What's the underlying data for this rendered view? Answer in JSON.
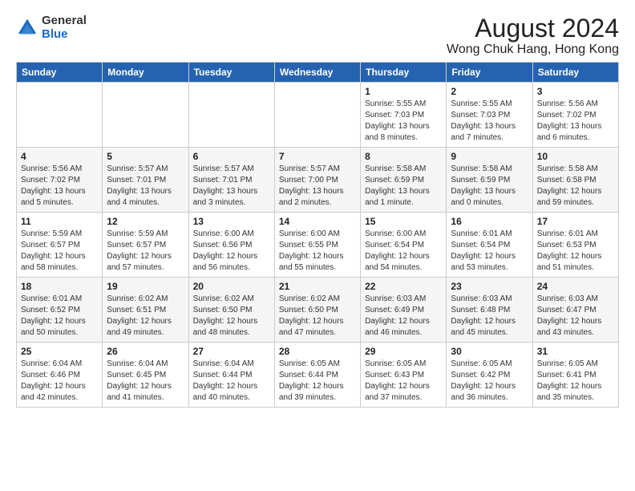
{
  "logo": {
    "general": "General",
    "blue": "Blue"
  },
  "header": {
    "title": "August 2024",
    "subtitle": "Wong Chuk Hang, Hong Kong"
  },
  "weekdays": [
    "Sunday",
    "Monday",
    "Tuesday",
    "Wednesday",
    "Thursday",
    "Friday",
    "Saturday"
  ],
  "weeks": [
    [
      {
        "day": "",
        "details": ""
      },
      {
        "day": "",
        "details": ""
      },
      {
        "day": "",
        "details": ""
      },
      {
        "day": "",
        "details": ""
      },
      {
        "day": "1",
        "details": "Sunrise: 5:55 AM\nSunset: 7:03 PM\nDaylight: 13 hours\nand 8 minutes."
      },
      {
        "day": "2",
        "details": "Sunrise: 5:55 AM\nSunset: 7:03 PM\nDaylight: 13 hours\nand 7 minutes."
      },
      {
        "day": "3",
        "details": "Sunrise: 5:56 AM\nSunset: 7:02 PM\nDaylight: 13 hours\nand 6 minutes."
      }
    ],
    [
      {
        "day": "4",
        "details": "Sunrise: 5:56 AM\nSunset: 7:02 PM\nDaylight: 13 hours\nand 5 minutes."
      },
      {
        "day": "5",
        "details": "Sunrise: 5:57 AM\nSunset: 7:01 PM\nDaylight: 13 hours\nand 4 minutes."
      },
      {
        "day": "6",
        "details": "Sunrise: 5:57 AM\nSunset: 7:01 PM\nDaylight: 13 hours\nand 3 minutes."
      },
      {
        "day": "7",
        "details": "Sunrise: 5:57 AM\nSunset: 7:00 PM\nDaylight: 13 hours\nand 2 minutes."
      },
      {
        "day": "8",
        "details": "Sunrise: 5:58 AM\nSunset: 6:59 PM\nDaylight: 13 hours\nand 1 minute."
      },
      {
        "day": "9",
        "details": "Sunrise: 5:58 AM\nSunset: 6:59 PM\nDaylight: 13 hours\nand 0 minutes."
      },
      {
        "day": "10",
        "details": "Sunrise: 5:58 AM\nSunset: 6:58 PM\nDaylight: 12 hours\nand 59 minutes."
      }
    ],
    [
      {
        "day": "11",
        "details": "Sunrise: 5:59 AM\nSunset: 6:57 PM\nDaylight: 12 hours\nand 58 minutes."
      },
      {
        "day": "12",
        "details": "Sunrise: 5:59 AM\nSunset: 6:57 PM\nDaylight: 12 hours\nand 57 minutes."
      },
      {
        "day": "13",
        "details": "Sunrise: 6:00 AM\nSunset: 6:56 PM\nDaylight: 12 hours\nand 56 minutes."
      },
      {
        "day": "14",
        "details": "Sunrise: 6:00 AM\nSunset: 6:55 PM\nDaylight: 12 hours\nand 55 minutes."
      },
      {
        "day": "15",
        "details": "Sunrise: 6:00 AM\nSunset: 6:54 PM\nDaylight: 12 hours\nand 54 minutes."
      },
      {
        "day": "16",
        "details": "Sunrise: 6:01 AM\nSunset: 6:54 PM\nDaylight: 12 hours\nand 53 minutes."
      },
      {
        "day": "17",
        "details": "Sunrise: 6:01 AM\nSunset: 6:53 PM\nDaylight: 12 hours\nand 51 minutes."
      }
    ],
    [
      {
        "day": "18",
        "details": "Sunrise: 6:01 AM\nSunset: 6:52 PM\nDaylight: 12 hours\nand 50 minutes."
      },
      {
        "day": "19",
        "details": "Sunrise: 6:02 AM\nSunset: 6:51 PM\nDaylight: 12 hours\nand 49 minutes."
      },
      {
        "day": "20",
        "details": "Sunrise: 6:02 AM\nSunset: 6:50 PM\nDaylight: 12 hours\nand 48 minutes."
      },
      {
        "day": "21",
        "details": "Sunrise: 6:02 AM\nSunset: 6:50 PM\nDaylight: 12 hours\nand 47 minutes."
      },
      {
        "day": "22",
        "details": "Sunrise: 6:03 AM\nSunset: 6:49 PM\nDaylight: 12 hours\nand 46 minutes."
      },
      {
        "day": "23",
        "details": "Sunrise: 6:03 AM\nSunset: 6:48 PM\nDaylight: 12 hours\nand 45 minutes."
      },
      {
        "day": "24",
        "details": "Sunrise: 6:03 AM\nSunset: 6:47 PM\nDaylight: 12 hours\nand 43 minutes."
      }
    ],
    [
      {
        "day": "25",
        "details": "Sunrise: 6:04 AM\nSunset: 6:46 PM\nDaylight: 12 hours\nand 42 minutes."
      },
      {
        "day": "26",
        "details": "Sunrise: 6:04 AM\nSunset: 6:45 PM\nDaylight: 12 hours\nand 41 minutes."
      },
      {
        "day": "27",
        "details": "Sunrise: 6:04 AM\nSunset: 6:44 PM\nDaylight: 12 hours\nand 40 minutes."
      },
      {
        "day": "28",
        "details": "Sunrise: 6:05 AM\nSunset: 6:44 PM\nDaylight: 12 hours\nand 39 minutes."
      },
      {
        "day": "29",
        "details": "Sunrise: 6:05 AM\nSunset: 6:43 PM\nDaylight: 12 hours\nand 37 minutes."
      },
      {
        "day": "30",
        "details": "Sunrise: 6:05 AM\nSunset: 6:42 PM\nDaylight: 12 hours\nand 36 minutes."
      },
      {
        "day": "31",
        "details": "Sunrise: 6:05 AM\nSunset: 6:41 PM\nDaylight: 12 hours\nand 35 minutes."
      }
    ]
  ]
}
